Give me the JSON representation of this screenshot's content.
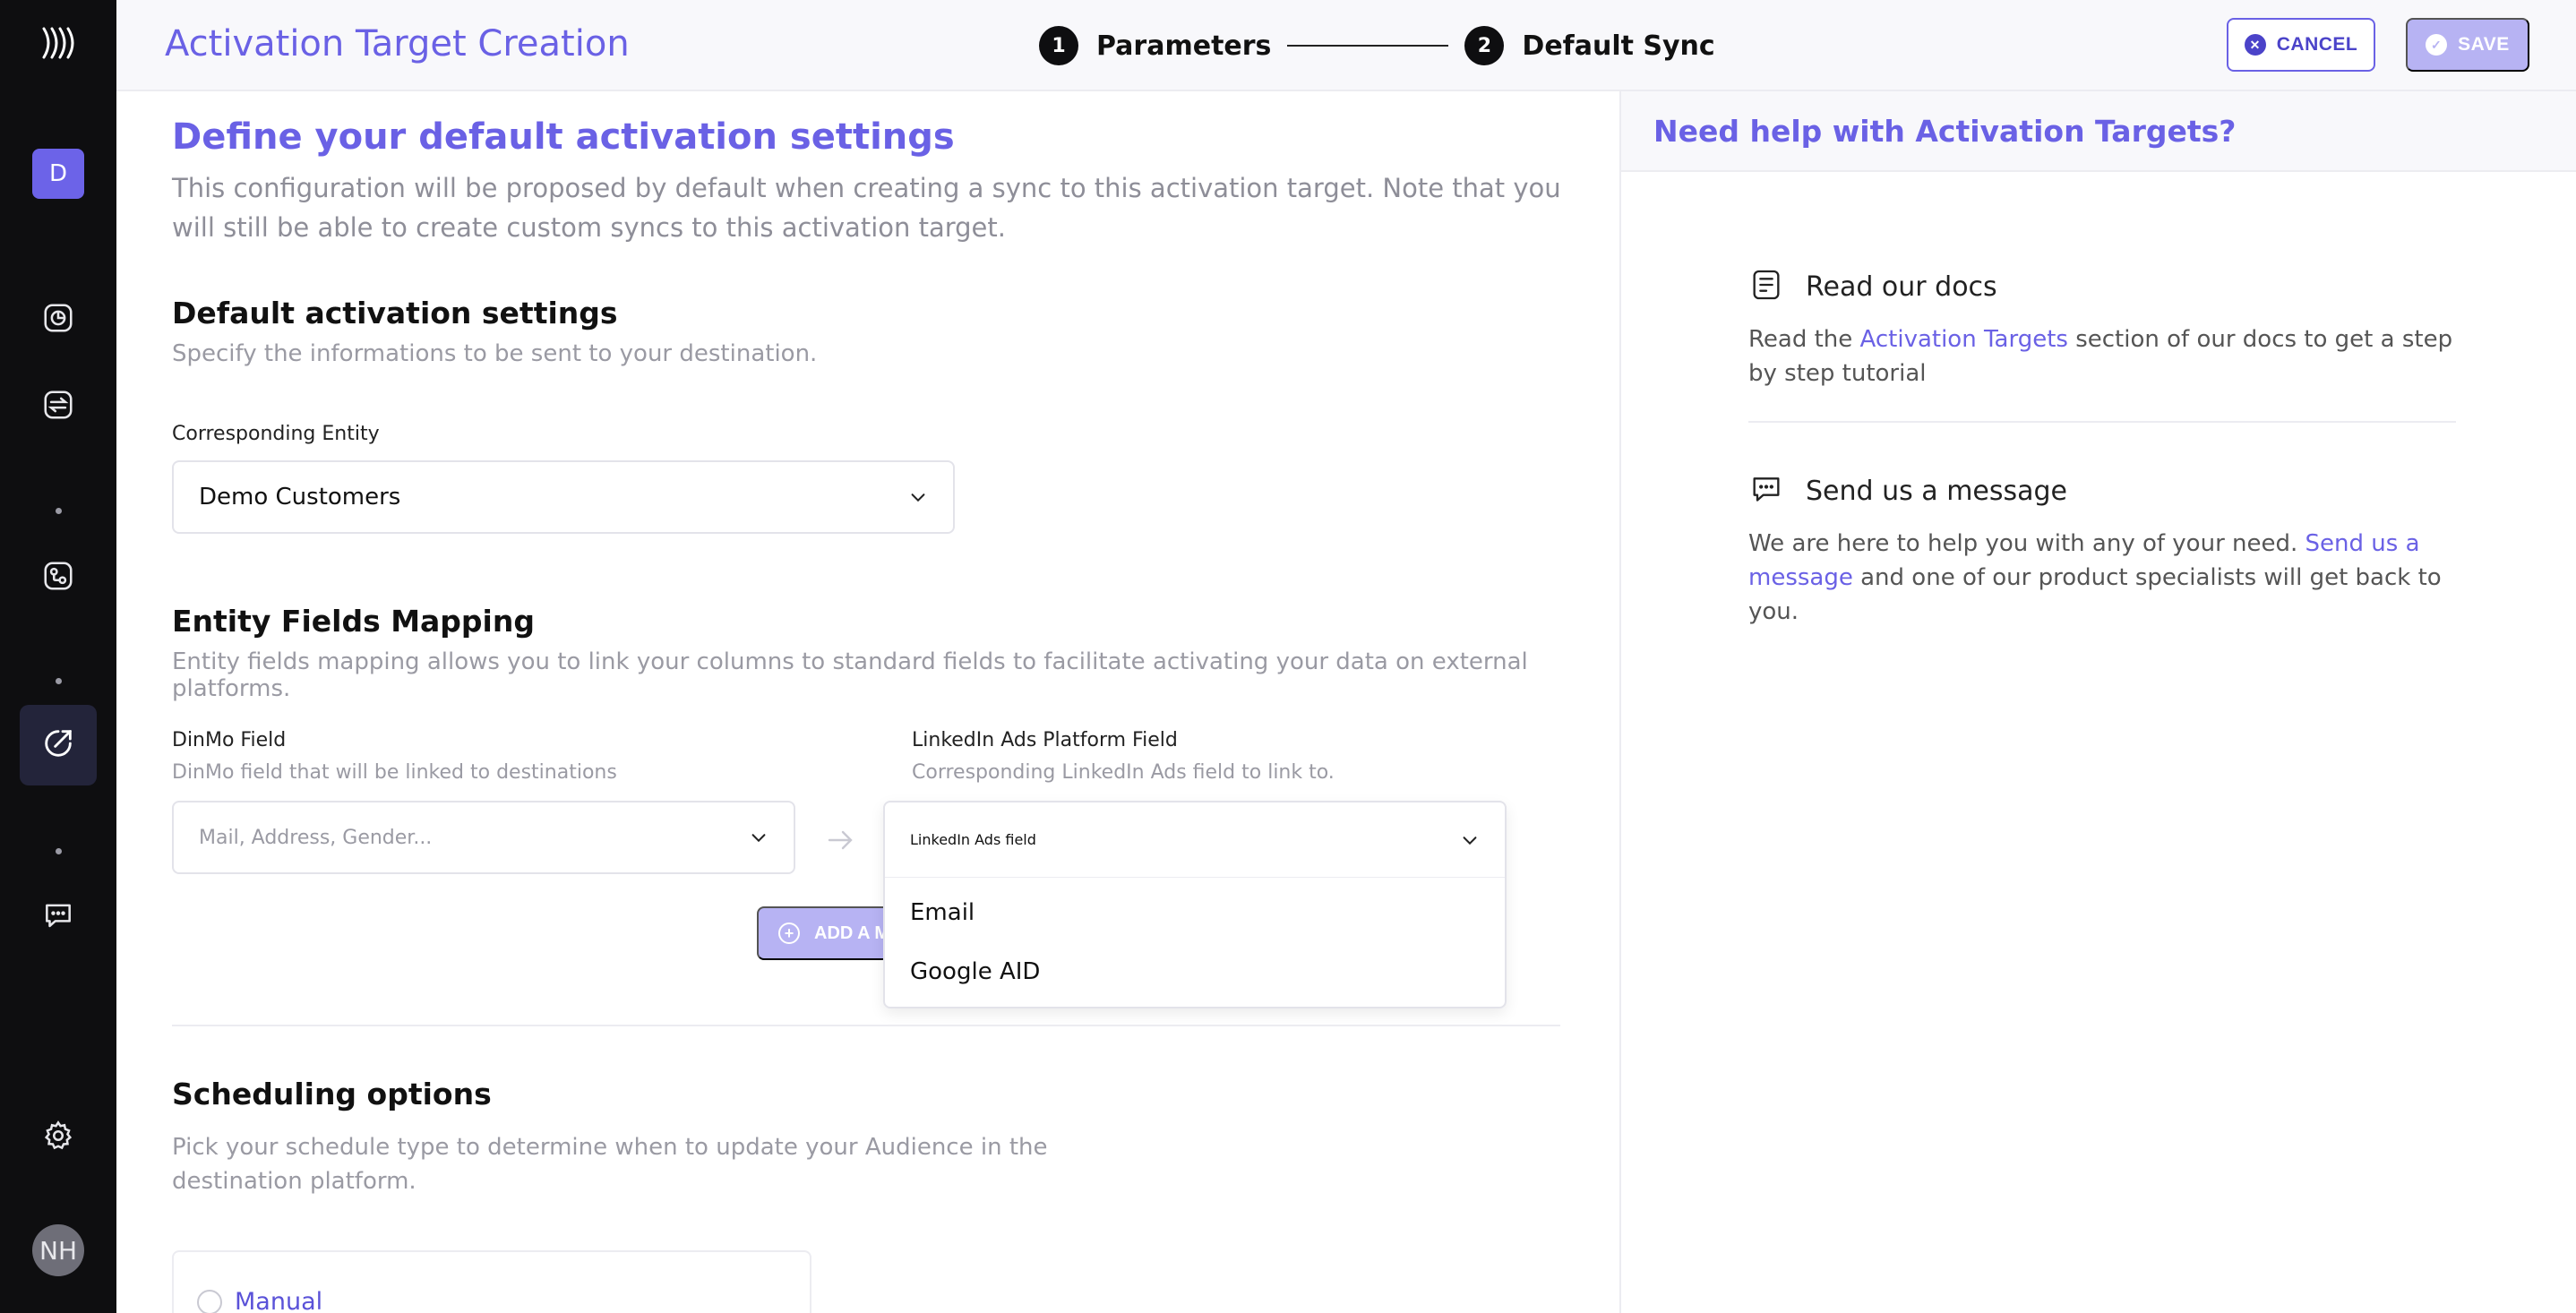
{
  "sidebar": {
    "logo_icon": "brand-logo-icon",
    "workspace_initial": "D",
    "icons": [
      "analytics-icon",
      "sync-icon",
      "workflow-icon",
      "activation-icon",
      "chat-icon",
      "gear-icon"
    ],
    "user_initials": "NH"
  },
  "header": {
    "title": "Activation Target Creation",
    "steps": [
      {
        "number": "1",
        "label": "Parameters"
      },
      {
        "number": "2",
        "label": "Default Sync"
      }
    ],
    "cancel_label": "CANCEL",
    "save_label": "SAVE"
  },
  "main": {
    "heading": "Define your default activation settings",
    "intro": "This configuration will be proposed by default when creating a sync to this activation target. Note that you will still be able to create custom syncs to this activation target.",
    "default_settings": {
      "title": "Default activation settings",
      "subtitle": "Specify the informations to be sent to your destination.",
      "entity_label": "Corresponding Entity",
      "entity_value": "Demo Customers"
    },
    "mapping": {
      "title": "Entity Fields Mapping",
      "subtitle": "Entity fields mapping allows you to link your columns to standard fields to facilitate activating your data on external platforms.",
      "dinmo_label": "DinMo Field",
      "dinmo_sub": "DinMo field that will be linked to destinations",
      "dinmo_placeholder": "Mail, Address, Gender...",
      "platform_label": "LinkedIn Ads Platform Field",
      "platform_sub": "Corresponding LinkedIn Ads field to link to.",
      "platform_placeholder": "LinkedIn Ads field",
      "add_label": "ADD A M",
      "options": [
        "Email",
        "Google AID"
      ]
    },
    "scheduling": {
      "title": "Scheduling options",
      "subtitle": "Pick your schedule type to determine when to update your Audience in the destination platform.",
      "option_manual": "Manual"
    }
  },
  "help": {
    "title": "Need help with Activation Targets?",
    "docs": {
      "title": "Read our docs",
      "text_before": "Read the ",
      "link": "Activation Targets",
      "text_after": " section of our docs to get a step by step tutorial"
    },
    "message": {
      "title": "Send us a message",
      "text_before": "We are here to help you with any of your need. ",
      "link": "Send us a message",
      "text_after": " and one of our product specialists will get back to you."
    }
  },
  "colors": {
    "accent": "#6a61e5",
    "sidebar_bg": "#0e0e10",
    "disabled_button": "#b7b3f3"
  }
}
